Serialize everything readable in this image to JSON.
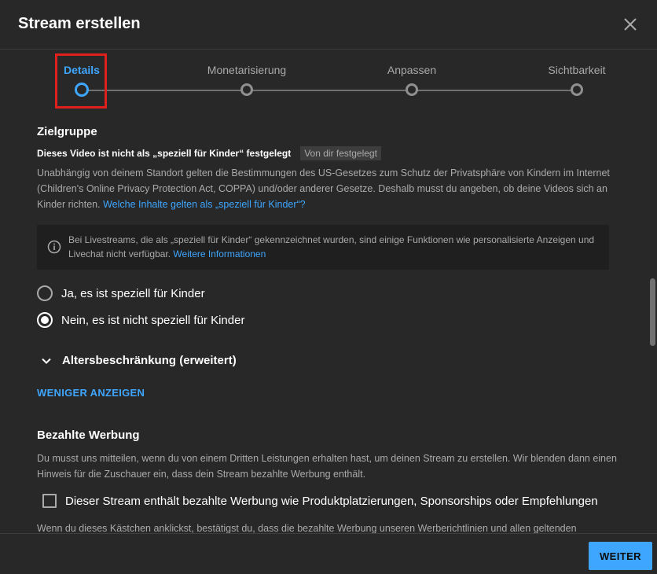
{
  "dialog": {
    "title": "Stream erstellen"
  },
  "stepper": {
    "steps": [
      {
        "label": "Details",
        "active": true
      },
      {
        "label": "Monetarisierung",
        "active": false
      },
      {
        "label": "Anpassen",
        "active": false
      },
      {
        "label": "Sichtbarkeit",
        "active": false
      }
    ]
  },
  "audience": {
    "title": "Zielgruppe",
    "status": "Dieses Video ist nicht als „speziell für Kinder“ festgelegt",
    "chip": "Von dir festgelegt",
    "description": "Unabhängig von deinem Standort gelten die Bestimmungen des US-Gesetzes zum Schutz der Privatsphäre von Kindern im Internet (Children's Online Privacy Protection Act, COPPA) und/oder anderer Gesetze. Deshalb musst du angeben, ob deine Videos sich an Kinder richten.",
    "description_link": "Welche Inhalte gelten als „speziell für Kinder“?",
    "info_text": "Bei Livestreams, die als „speziell für Kinder“ gekennzeichnet wurden, sind einige Funktionen wie personalisierte Anzeigen und Livechat nicht verfügbar.",
    "info_link": "Weitere Informationen",
    "options": [
      {
        "label": "Ja, es ist speziell für Kinder",
        "checked": false
      },
      {
        "label": "Nein, es ist nicht speziell für Kinder",
        "checked": true
      }
    ],
    "age_restriction": "Altersbeschränkung (erweitert)",
    "show_less": "WENIGER ANZEIGEN"
  },
  "paid_promotion": {
    "title": "Bezahlte Werbung",
    "description": "Du musst uns mitteilen, wenn du von einem Dritten Leistungen erhalten hast, um deinen Stream zu erstellen. Wir blenden dann einen Hinweis für die Zuschauer ein, dass dein Stream bezahlte Werbung enthält.",
    "checkbox_label": "Dieser Stream enthält bezahlte Werbung wie Produktplatzierungen, Sponsorships oder Empfehlungen",
    "checkbox_checked": false,
    "note": "Wenn du dieses Kästchen anklickst, bestätigst du, dass die bezahlte Werbung unseren Werberichtlinien und allen geltenden"
  },
  "footer": {
    "next_label": "WEITER"
  },
  "colors": {
    "background": "#282828",
    "accent": "#3ea6ff",
    "highlight": "#e0201c"
  }
}
